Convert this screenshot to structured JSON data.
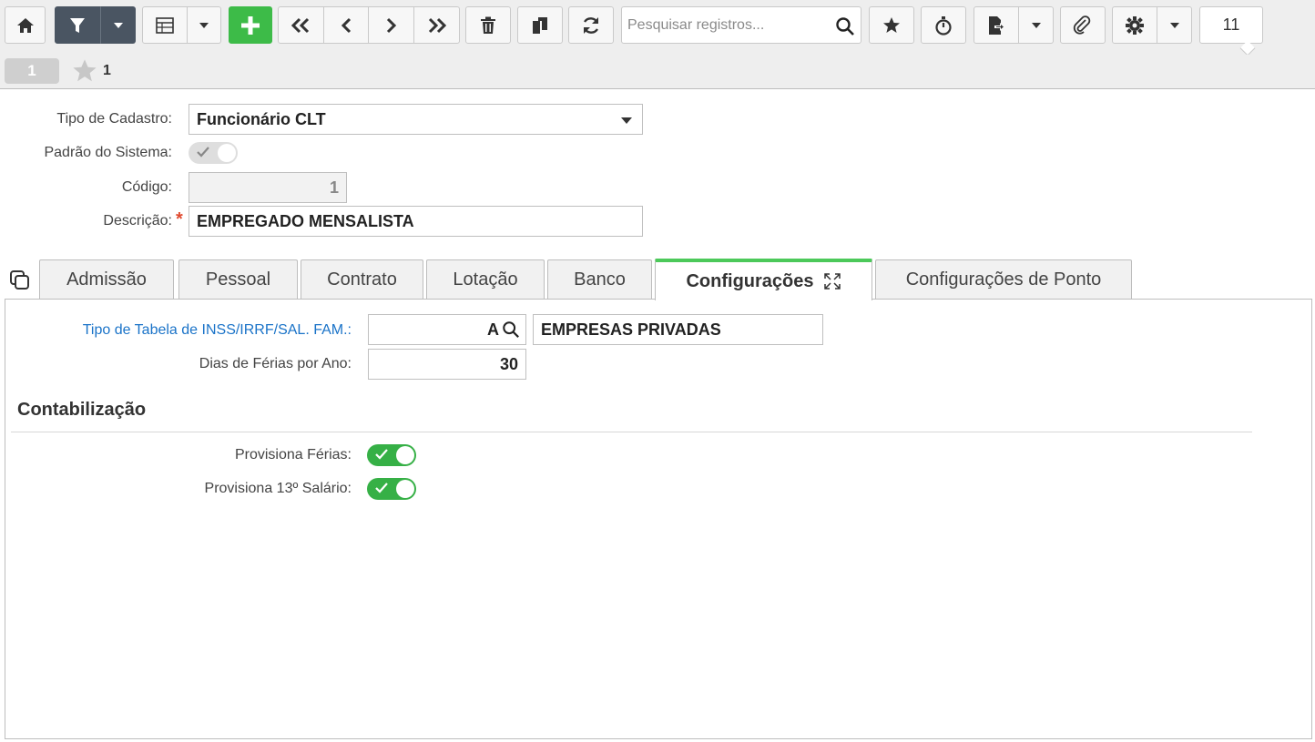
{
  "toolbar": {
    "search_placeholder": "Pesquisar registros...",
    "record_count": "11"
  },
  "record_bar": {
    "current_record": "1",
    "favorites_count": "1"
  },
  "form": {
    "tipo_cadastro": {
      "label": "Tipo de Cadastro:",
      "value": "Funcionário CLT"
    },
    "padrao_sistema": {
      "label": "Padrão do Sistema:",
      "checked": true,
      "disabled": true
    },
    "codigo": {
      "label": "Código:",
      "value": "1"
    },
    "descricao": {
      "label": "Descrição:",
      "value": "EMPREGADO MENSALISTA",
      "required_mark": "*"
    }
  },
  "tabs": [
    {
      "label": "Admissão"
    },
    {
      "label": "Pessoal"
    },
    {
      "label": "Contrato"
    },
    {
      "label": "Lotação"
    },
    {
      "label": "Banco"
    },
    {
      "label": "Configurações",
      "active": true
    },
    {
      "label": "Configurações de Ponto"
    }
  ],
  "config": {
    "tipo_tabela": {
      "label": "Tipo de Tabela de INSS/IRRF/SAL. FAM.:",
      "code": "A",
      "description": "EMPRESAS PRIVADAS"
    },
    "dias_ferias": {
      "label": "Dias de Férias por Ano:",
      "value": "30"
    },
    "section_title": "Contabilização",
    "provisiona_ferias": {
      "label": "Provisiona Férias:",
      "checked": true
    },
    "provisiona_13": {
      "label": "Provisiona 13º Salário:",
      "checked": true
    }
  },
  "colors": {
    "accent_green": "#3dbb48",
    "toolbar_dark": "#4a5562",
    "link_blue": "#1a73c8",
    "required_red": "#e04a2f"
  }
}
